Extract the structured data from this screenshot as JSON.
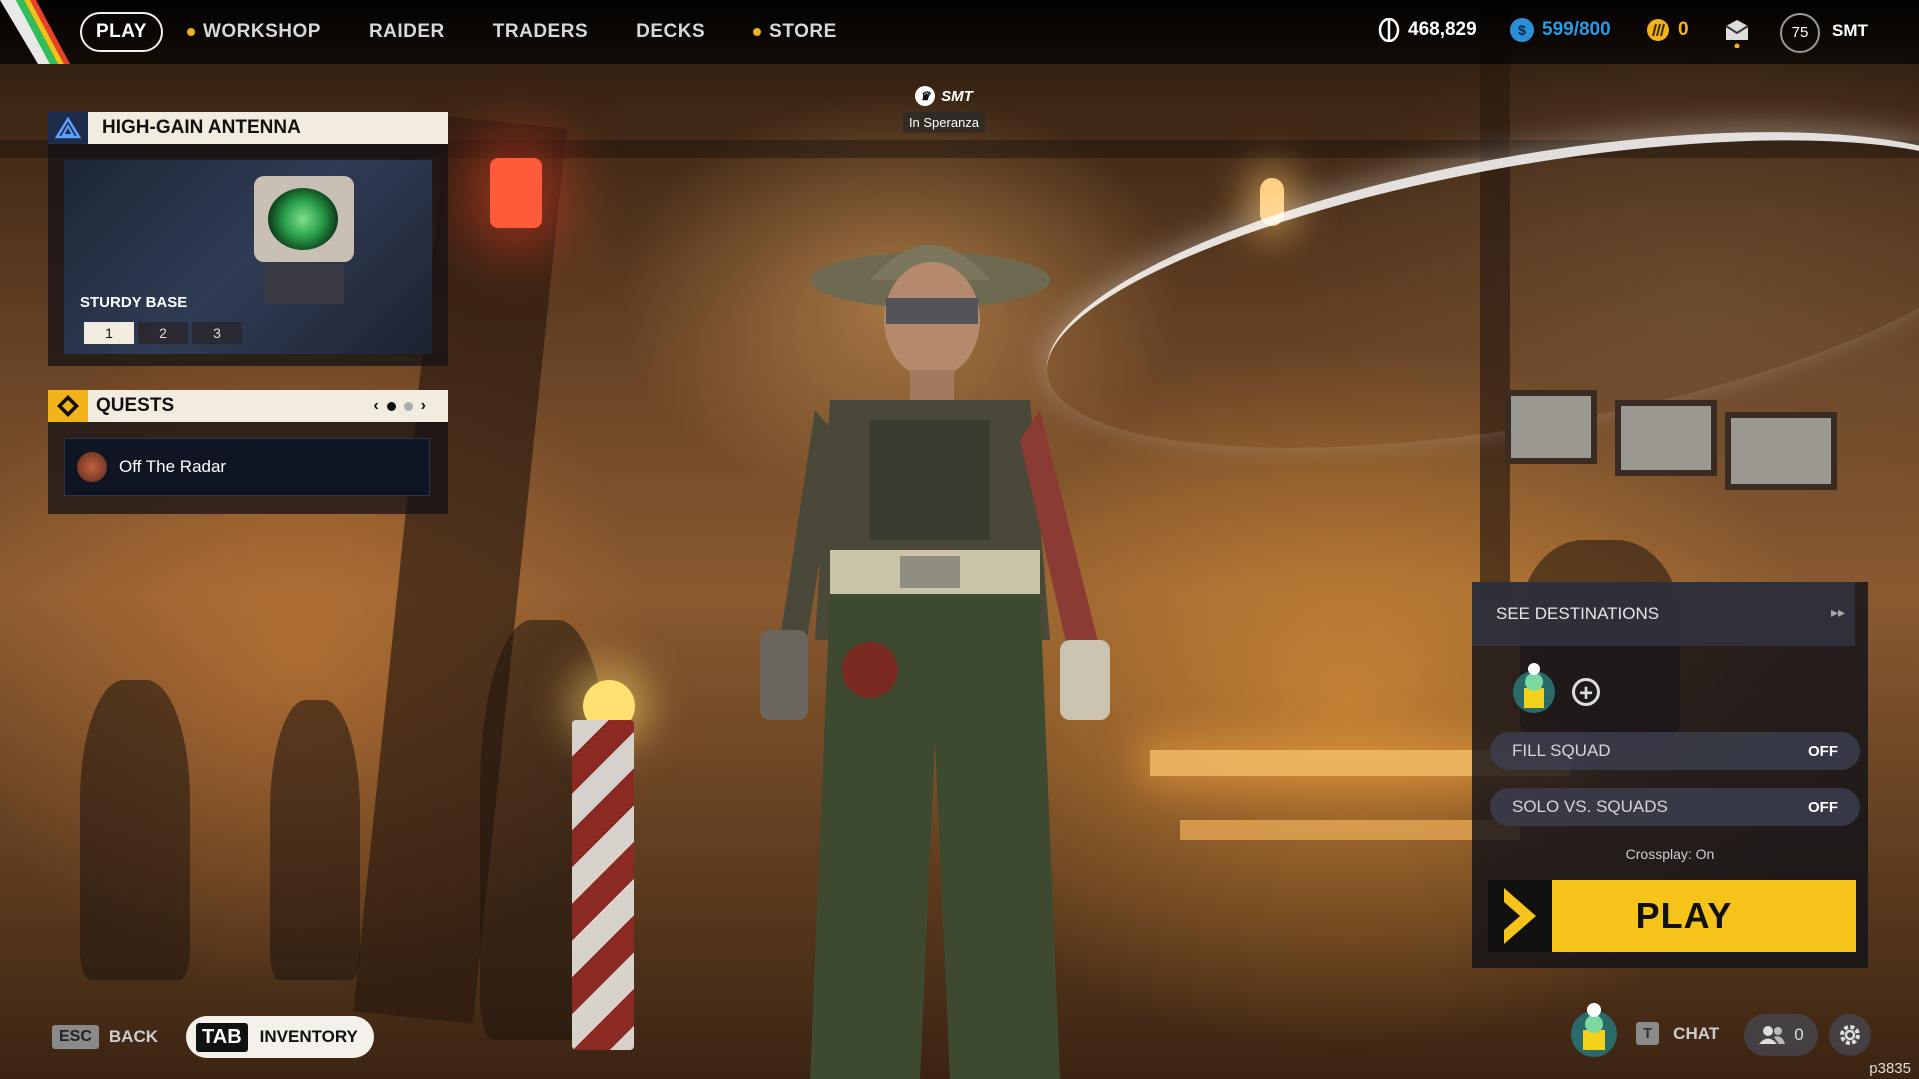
{
  "nav": {
    "items": [
      {
        "label": "PLAY",
        "active": true,
        "dot": false
      },
      {
        "label": "WORKSHOP",
        "active": false,
        "dot": true
      },
      {
        "label": "RAIDER",
        "active": false,
        "dot": false
      },
      {
        "label": "TRADERS",
        "active": false,
        "dot": false
      },
      {
        "label": "DECKS",
        "active": false,
        "dot": false
      },
      {
        "label": "STORE",
        "active": false,
        "dot": true
      }
    ]
  },
  "currencies": {
    "coins": "468,829",
    "raider_tokens": "599/800",
    "cred": "0"
  },
  "profile": {
    "level": "75",
    "name": "SMT"
  },
  "antenna": {
    "title": "HIGH-GAIN ANTENNA",
    "subtitle": "STURDY BASE",
    "tiers": [
      "1",
      "2",
      "3"
    ]
  },
  "quests": {
    "title": "QUESTS",
    "items": [
      "Off The Radar"
    ]
  },
  "player_tag": {
    "name": "SMT",
    "location": "In Speranza"
  },
  "play_panel": {
    "destinations_label": "SEE DESTINATIONS",
    "fill_squad_label": "FILL SQUAD",
    "fill_squad_value": "OFF",
    "solo_label": "SOLO VS. SQUADS",
    "solo_value": "OFF",
    "crossplay": "Crossplay: On",
    "play_label": "PLAY"
  },
  "bottom": {
    "esc_key": "ESC",
    "back_label": "BACK",
    "tab_key": "TAB",
    "inventory_label": "INVENTORY",
    "chat_key": "T",
    "chat_label": "CHAT",
    "friends_count": "0",
    "build": "p3835"
  },
  "colors": {
    "accent_yellow": "#f5c31a",
    "panel_header": "#f2ece0",
    "token_blue": "#2a8ed8"
  }
}
